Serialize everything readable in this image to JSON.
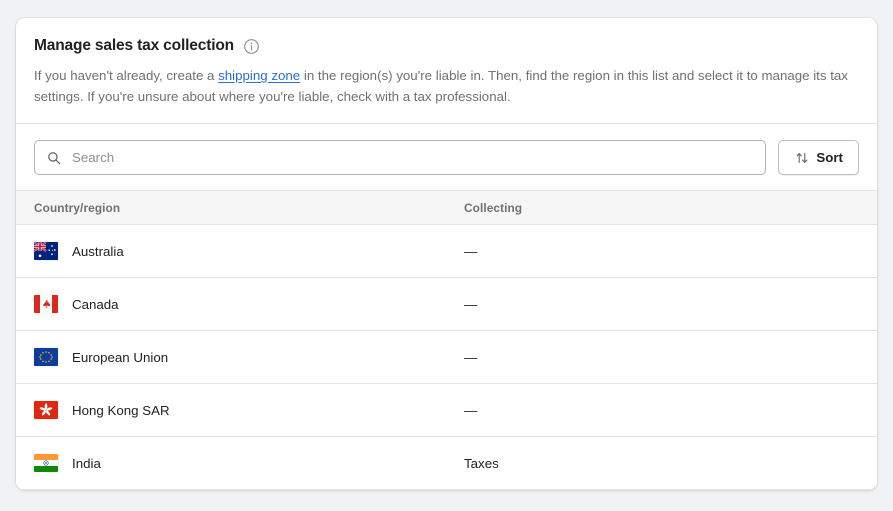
{
  "card": {
    "title": "Manage sales tax collection",
    "info_icon": "info-circle-icon",
    "description_before_link": "If you haven't already, create a ",
    "description_link": "shipping zone",
    "description_after_link": " in the region(s) you're liable in. Then, find the region in this list and select it to manage its tax settings. If you're unsure about where you're liable, check with a tax professional."
  },
  "search": {
    "icon": "search-icon",
    "placeholder": "Search",
    "value": ""
  },
  "sort": {
    "icon": "sort-arrows-icon",
    "label": "Sort"
  },
  "table": {
    "columns": {
      "region": "Country/region",
      "collecting": "Collecting"
    },
    "rows": [
      {
        "flag": "flag-australia",
        "region": "Australia",
        "collecting": "—"
      },
      {
        "flag": "flag-canada",
        "region": "Canada",
        "collecting": "—"
      },
      {
        "flag": "flag-european-union",
        "region": "European Union",
        "collecting": "—"
      },
      {
        "flag": "flag-hong-kong",
        "region": "Hong Kong SAR",
        "collecting": "—"
      },
      {
        "flag": "flag-india",
        "region": "India",
        "collecting": "Taxes"
      }
    ]
  },
  "colors": {
    "page_background": "#f1f2f3",
    "card_background": "#ffffff",
    "text_primary": "#202223",
    "text_subdued": "#6d7175",
    "link": "#2c6ecb",
    "border": "#e1e3e5",
    "table_header_background": "#f6f6f7"
  }
}
